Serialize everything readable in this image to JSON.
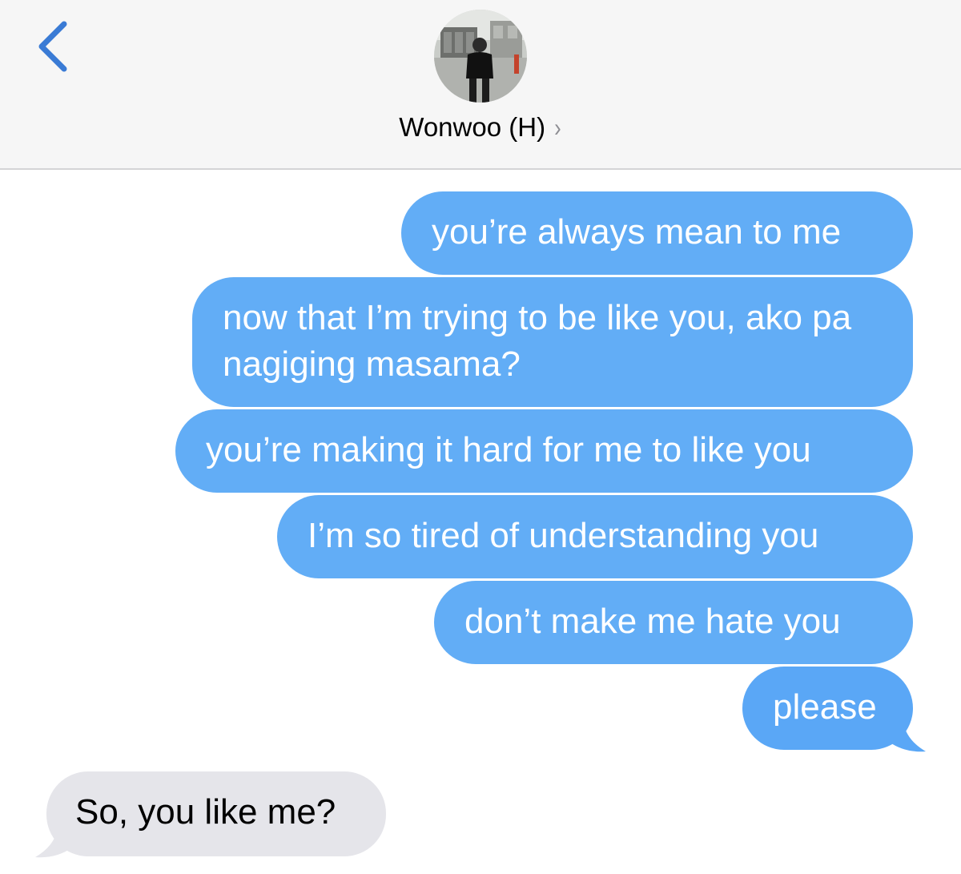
{
  "header": {
    "back_icon": "chevron-left-icon",
    "contact_name": "Wonwoo (H)",
    "contact_chevron": "›",
    "avatar_icon": "contact-photo"
  },
  "colors": {
    "sent_bubble": "#62adf6",
    "received_bubble": "#e5e5ea",
    "accent": "#3a7bd5",
    "header_bg": "#f6f6f6"
  },
  "messages": [
    {
      "direction": "sent",
      "text": "you’re always mean to me"
    },
    {
      "direction": "sent",
      "text": "now that I’m trying to be like you, ako pa nagiging masama?"
    },
    {
      "direction": "sent",
      "text": "you’re making it hard for me to like you"
    },
    {
      "direction": "sent",
      "text": "I’m so tired of understanding you"
    },
    {
      "direction": "sent",
      "text": "don’t make me hate you"
    },
    {
      "direction": "sent",
      "text": "please"
    },
    {
      "direction": "received",
      "text": "So, you like me?"
    }
  ]
}
